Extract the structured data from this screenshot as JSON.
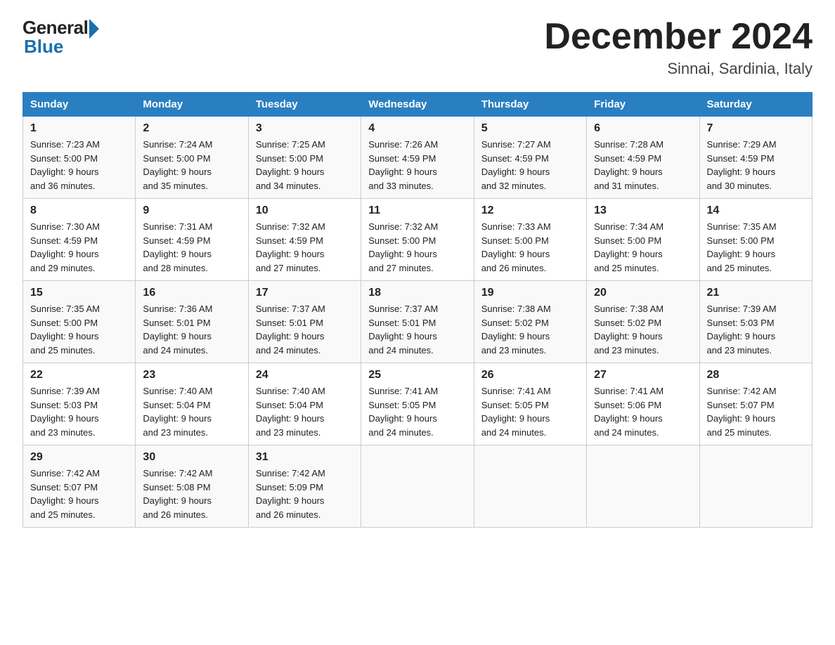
{
  "header": {
    "logo_general": "General",
    "logo_blue": "Blue",
    "month_title": "December 2024",
    "location": "Sinnai, Sardinia, Italy"
  },
  "weekdays": [
    "Sunday",
    "Monday",
    "Tuesday",
    "Wednesday",
    "Thursday",
    "Friday",
    "Saturday"
  ],
  "weeks": [
    [
      {
        "day": "1",
        "sunrise": "7:23 AM",
        "sunset": "5:00 PM",
        "daylight": "9 hours and 36 minutes."
      },
      {
        "day": "2",
        "sunrise": "7:24 AM",
        "sunset": "5:00 PM",
        "daylight": "9 hours and 35 minutes."
      },
      {
        "day": "3",
        "sunrise": "7:25 AM",
        "sunset": "5:00 PM",
        "daylight": "9 hours and 34 minutes."
      },
      {
        "day": "4",
        "sunrise": "7:26 AM",
        "sunset": "4:59 PM",
        "daylight": "9 hours and 33 minutes."
      },
      {
        "day": "5",
        "sunrise": "7:27 AM",
        "sunset": "4:59 PM",
        "daylight": "9 hours and 32 minutes."
      },
      {
        "day": "6",
        "sunrise": "7:28 AM",
        "sunset": "4:59 PM",
        "daylight": "9 hours and 31 minutes."
      },
      {
        "day": "7",
        "sunrise": "7:29 AM",
        "sunset": "4:59 PM",
        "daylight": "9 hours and 30 minutes."
      }
    ],
    [
      {
        "day": "8",
        "sunrise": "7:30 AM",
        "sunset": "4:59 PM",
        "daylight": "9 hours and 29 minutes."
      },
      {
        "day": "9",
        "sunrise": "7:31 AM",
        "sunset": "4:59 PM",
        "daylight": "9 hours and 28 minutes."
      },
      {
        "day": "10",
        "sunrise": "7:32 AM",
        "sunset": "4:59 PM",
        "daylight": "9 hours and 27 minutes."
      },
      {
        "day": "11",
        "sunrise": "7:32 AM",
        "sunset": "5:00 PM",
        "daylight": "9 hours and 27 minutes."
      },
      {
        "day": "12",
        "sunrise": "7:33 AM",
        "sunset": "5:00 PM",
        "daylight": "9 hours and 26 minutes."
      },
      {
        "day": "13",
        "sunrise": "7:34 AM",
        "sunset": "5:00 PM",
        "daylight": "9 hours and 25 minutes."
      },
      {
        "day": "14",
        "sunrise": "7:35 AM",
        "sunset": "5:00 PM",
        "daylight": "9 hours and 25 minutes."
      }
    ],
    [
      {
        "day": "15",
        "sunrise": "7:35 AM",
        "sunset": "5:00 PM",
        "daylight": "9 hours and 25 minutes."
      },
      {
        "day": "16",
        "sunrise": "7:36 AM",
        "sunset": "5:01 PM",
        "daylight": "9 hours and 24 minutes."
      },
      {
        "day": "17",
        "sunrise": "7:37 AM",
        "sunset": "5:01 PM",
        "daylight": "9 hours and 24 minutes."
      },
      {
        "day": "18",
        "sunrise": "7:37 AM",
        "sunset": "5:01 PM",
        "daylight": "9 hours and 24 minutes."
      },
      {
        "day": "19",
        "sunrise": "7:38 AM",
        "sunset": "5:02 PM",
        "daylight": "9 hours and 23 minutes."
      },
      {
        "day": "20",
        "sunrise": "7:38 AM",
        "sunset": "5:02 PM",
        "daylight": "9 hours and 23 minutes."
      },
      {
        "day": "21",
        "sunrise": "7:39 AM",
        "sunset": "5:03 PM",
        "daylight": "9 hours and 23 minutes."
      }
    ],
    [
      {
        "day": "22",
        "sunrise": "7:39 AM",
        "sunset": "5:03 PM",
        "daylight": "9 hours and 23 minutes."
      },
      {
        "day": "23",
        "sunrise": "7:40 AM",
        "sunset": "5:04 PM",
        "daylight": "9 hours and 23 minutes."
      },
      {
        "day": "24",
        "sunrise": "7:40 AM",
        "sunset": "5:04 PM",
        "daylight": "9 hours and 23 minutes."
      },
      {
        "day": "25",
        "sunrise": "7:41 AM",
        "sunset": "5:05 PM",
        "daylight": "9 hours and 24 minutes."
      },
      {
        "day": "26",
        "sunrise": "7:41 AM",
        "sunset": "5:05 PM",
        "daylight": "9 hours and 24 minutes."
      },
      {
        "day": "27",
        "sunrise": "7:41 AM",
        "sunset": "5:06 PM",
        "daylight": "9 hours and 24 minutes."
      },
      {
        "day": "28",
        "sunrise": "7:42 AM",
        "sunset": "5:07 PM",
        "daylight": "9 hours and 25 minutes."
      }
    ],
    [
      {
        "day": "29",
        "sunrise": "7:42 AM",
        "sunset": "5:07 PM",
        "daylight": "9 hours and 25 minutes."
      },
      {
        "day": "30",
        "sunrise": "7:42 AM",
        "sunset": "5:08 PM",
        "daylight": "9 hours and 26 minutes."
      },
      {
        "day": "31",
        "sunrise": "7:42 AM",
        "sunset": "5:09 PM",
        "daylight": "9 hours and 26 minutes."
      },
      null,
      null,
      null,
      null
    ]
  ],
  "labels": {
    "sunrise": "Sunrise:",
    "sunset": "Sunset:",
    "daylight": "Daylight:"
  }
}
